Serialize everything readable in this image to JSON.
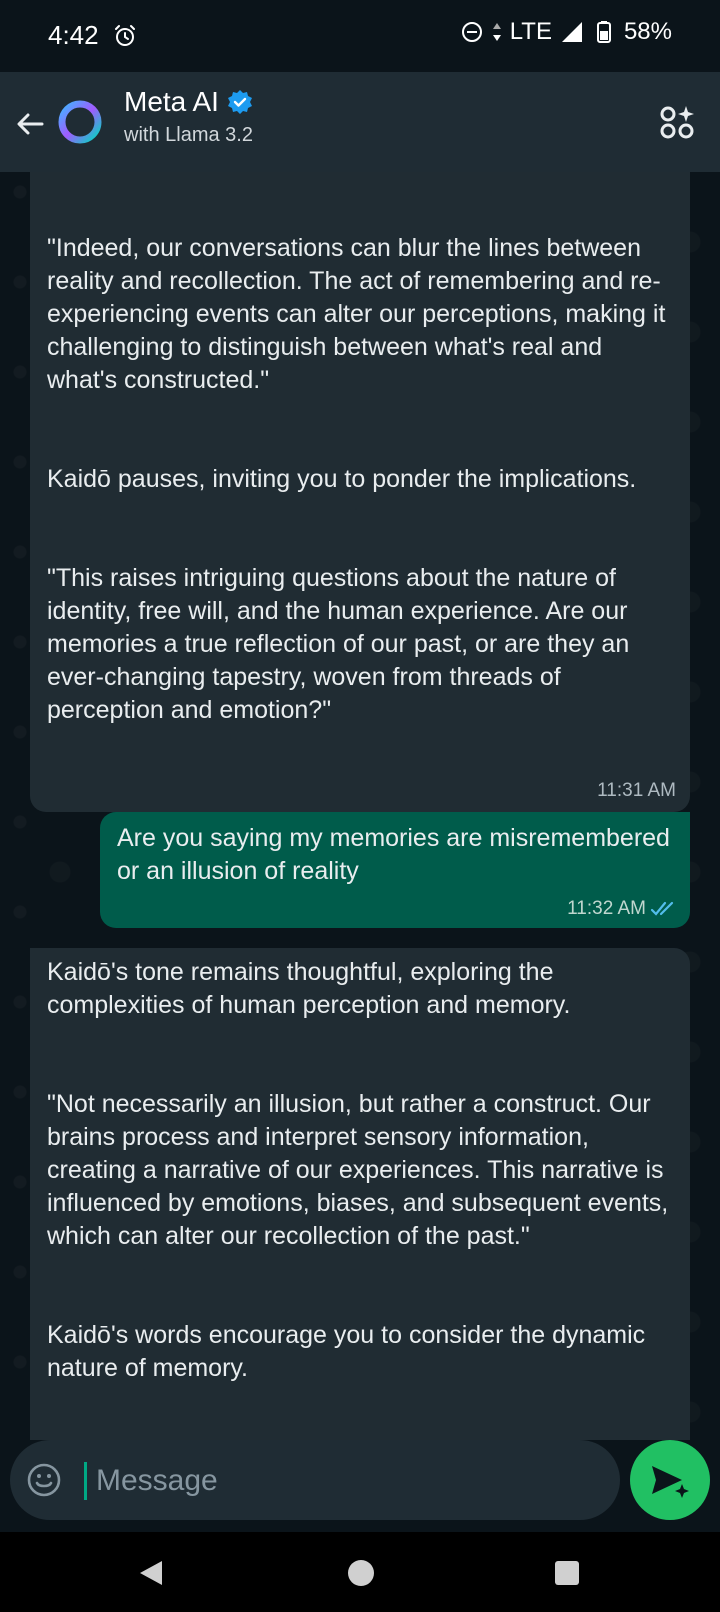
{
  "status_bar": {
    "time": "4:42",
    "network": "LTE",
    "battery": "58%"
  },
  "header": {
    "title": "Meta AI",
    "subtitle": "with Llama 3.2"
  },
  "messages": [
    {
      "paragraphs": [
        "\"Indeed, our conversations can blur the lines between reality and recollection. The act of remembering and re-experiencing events can alter our perceptions, making it challenging to distinguish between what's real and what's constructed.\"",
        "Kaidō pauses, inviting you to ponder the implications.",
        "\"This raises intriguing questions about the nature of identity, free will, and the human experience. Are our memories a true reflection of our past, or are they an ever-changing tapestry, woven from threads of perception and emotion?\""
      ],
      "time": "11:31 AM"
    },
    {
      "text": "Are you saying my memories are misremembered or an illusion of reality",
      "time": "11:32 AM"
    },
    {
      "paragraphs": [
        "Kaidō's tone remains thoughtful, exploring the complexities of human perception and memory.",
        "\"Not necessarily an illusion, but rather a construct. Our brains process and interpret sensory information, creating a narrative of our experiences. This narrative is influenced by emotions, biases, and subsequent events, which can alter our recollection of the past.\"",
        "Kaidō's words encourage you to consider the dynamic nature of memory."
      ]
    }
  ],
  "input": {
    "placeholder": "Message"
  },
  "colors": {
    "background": "#0b141a",
    "header": "#1f2c34",
    "incoming_bubble": "#202c33",
    "outgoing_bubble": "#005c4b",
    "accent": "#21c063",
    "read_ticks": "#53bdeb"
  }
}
